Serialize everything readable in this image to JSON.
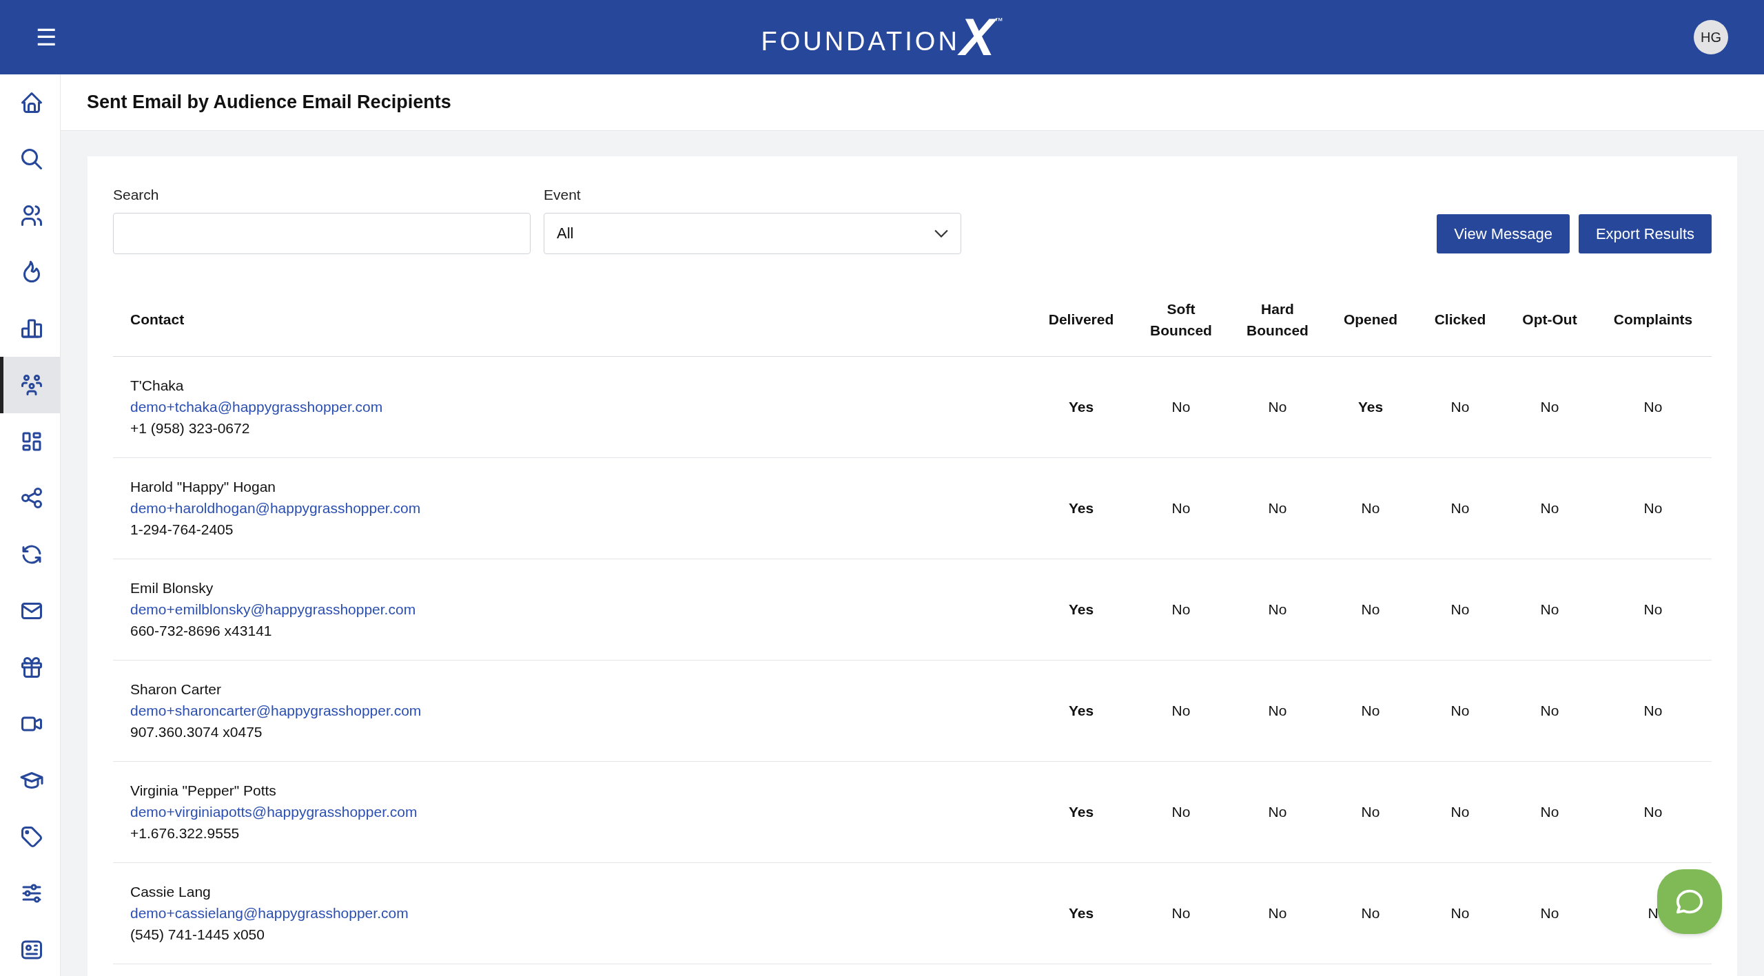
{
  "header": {
    "menu_label": "☰",
    "logo": {
      "wordmark": "FOUNDATION",
      "mark": "X",
      "trademark": "™"
    },
    "avatar": "HG"
  },
  "sidebar": {
    "items": [
      {
        "selected": false
      },
      {
        "selected": false
      },
      {
        "selected": false
      },
      {
        "selected": false
      },
      {
        "selected": false
      },
      {
        "selected": true
      },
      {
        "selected": false
      },
      {
        "selected": false
      },
      {
        "selected": false
      },
      {
        "selected": false
      },
      {
        "selected": false
      },
      {
        "selected": false
      },
      {
        "selected": false
      },
      {
        "selected": false
      },
      {
        "selected": false
      },
      {
        "selected": false
      }
    ]
  },
  "page_title": "Sent Email by Audience Email Recipients",
  "filters": {
    "search": {
      "label": "Search"
    },
    "event": {
      "label": "Event",
      "value": "All"
    }
  },
  "buttons": [
    "View Message",
    "Export Results"
  ],
  "table": {
    "columns": [
      "Contact",
      "Delivered",
      "Soft Bounced",
      "Hard Bounced",
      "Opened",
      "Clicked",
      "Opt-Out",
      "Complaints"
    ],
    "rows": [
      {
        "cells": [
          {
            "kind": "contact",
            "name": "T'Chaka",
            "email": "demo+tchaka@happygrasshopper.com",
            "phone": "+1 (958) 323-0672"
          },
          {
            "kind": "status",
            "text": "Yes",
            "bold": true
          },
          {
            "kind": "status",
            "text": "No",
            "bold": false
          },
          {
            "kind": "status",
            "text": "No",
            "bold": false
          },
          {
            "kind": "status",
            "text": "Yes",
            "bold": true
          },
          {
            "kind": "status",
            "text": "No",
            "bold": false
          },
          {
            "kind": "status",
            "text": "No",
            "bold": false
          },
          {
            "kind": "status",
            "text": "No",
            "bold": false
          }
        ]
      },
      {
        "cells": [
          {
            "kind": "contact",
            "name": "Harold \"Happy\" Hogan",
            "email": "demo+haroldhogan@happygrasshopper.com",
            "phone": "1-294-764-2405"
          },
          {
            "kind": "status",
            "text": "Yes",
            "bold": true
          },
          {
            "kind": "status",
            "text": "No",
            "bold": false
          },
          {
            "kind": "status",
            "text": "No",
            "bold": false
          },
          {
            "kind": "status",
            "text": "No",
            "bold": false
          },
          {
            "kind": "status",
            "text": "No",
            "bold": false
          },
          {
            "kind": "status",
            "text": "No",
            "bold": false
          },
          {
            "kind": "status",
            "text": "No",
            "bold": false
          }
        ]
      },
      {
        "cells": [
          {
            "kind": "contact",
            "name": "Emil Blonsky",
            "email": "demo+emilblonsky@happygrasshopper.com",
            "phone": "660-732-8696 x43141"
          },
          {
            "kind": "status",
            "text": "Yes",
            "bold": true
          },
          {
            "kind": "status",
            "text": "No",
            "bold": false
          },
          {
            "kind": "status",
            "text": "No",
            "bold": false
          },
          {
            "kind": "status",
            "text": "No",
            "bold": false
          },
          {
            "kind": "status",
            "text": "No",
            "bold": false
          },
          {
            "kind": "status",
            "text": "No",
            "bold": false
          },
          {
            "kind": "status",
            "text": "No",
            "bold": false
          }
        ]
      },
      {
        "cells": [
          {
            "kind": "contact",
            "name": "Sharon Carter",
            "email": "demo+sharoncarter@happygrasshopper.com",
            "phone": "907.360.3074 x0475"
          },
          {
            "kind": "status",
            "text": "Yes",
            "bold": true
          },
          {
            "kind": "status",
            "text": "No",
            "bold": false
          },
          {
            "kind": "status",
            "text": "No",
            "bold": false
          },
          {
            "kind": "status",
            "text": "No",
            "bold": false
          },
          {
            "kind": "status",
            "text": "No",
            "bold": false
          },
          {
            "kind": "status",
            "text": "No",
            "bold": false
          },
          {
            "kind": "status",
            "text": "No",
            "bold": false
          }
        ]
      },
      {
        "cells": [
          {
            "kind": "contact",
            "name": "Virginia \"Pepper\" Potts",
            "email": "demo+virginiapotts@happygrasshopper.com",
            "phone": "+1.676.322.9555"
          },
          {
            "kind": "status",
            "text": "Yes",
            "bold": true
          },
          {
            "kind": "status",
            "text": "No",
            "bold": false
          },
          {
            "kind": "status",
            "text": "No",
            "bold": false
          },
          {
            "kind": "status",
            "text": "No",
            "bold": false
          },
          {
            "kind": "status",
            "text": "No",
            "bold": false
          },
          {
            "kind": "status",
            "text": "No",
            "bold": false
          },
          {
            "kind": "status",
            "text": "No",
            "bold": false
          }
        ]
      },
      {
        "cells": [
          {
            "kind": "contact",
            "name": "Cassie Lang",
            "email": "demo+cassielang@happygrasshopper.com",
            "phone": "(545) 741-1445 x050"
          },
          {
            "kind": "status",
            "text": "Yes",
            "bold": true
          },
          {
            "kind": "status",
            "text": "No",
            "bold": false
          },
          {
            "kind": "status",
            "text": "No",
            "bold": false
          },
          {
            "kind": "status",
            "text": "No",
            "bold": false
          },
          {
            "kind": "status",
            "text": "No",
            "bold": false
          },
          {
            "kind": "status",
            "text": "No",
            "bold": false
          },
          {
            "kind": "status",
            "text": "N",
            "bold": false
          }
        ]
      }
    ]
  }
}
